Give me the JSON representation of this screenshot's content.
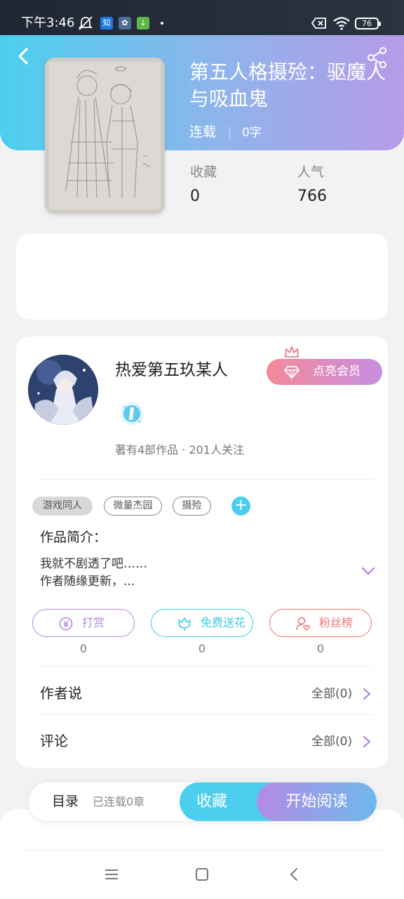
{
  "status_bar": {
    "time": "下午3:46",
    "app_icons": [
      "mute-bell-icon",
      "zhihu-icon",
      "gear-icon",
      "download-icon"
    ],
    "zhihu_glyph": "知",
    "battery": "76"
  },
  "book": {
    "title": "第五人格摄殓：驱魔人与吸血鬼",
    "status": "连载",
    "words": "0字",
    "stats": {
      "collect_label": "收藏",
      "collect_value": "0",
      "popularity_label": "人气",
      "popularity_value": "766"
    }
  },
  "author": {
    "name": "热爱第五玖某人",
    "vip_button": "点亮会员",
    "meta": "著有4部作品 · 201人关注"
  },
  "tags": [
    "游戏同人",
    "微量杰园",
    "摄殓"
  ],
  "tag_add": "+",
  "intro": {
    "title": "作品简介：",
    "lines": [
      "我就不剧透了吧……",
      "作者随缘更新，..."
    ]
  },
  "actions": [
    {
      "label": "打赏",
      "count": "0",
      "color": "#b58be3",
      "icon": "yen-coin-icon"
    },
    {
      "label": "免费送花",
      "count": "0",
      "color": "#3ecbe8",
      "icon": "flower-icon"
    },
    {
      "label": "粉丝榜",
      "count": "0",
      "color": "#ea7878",
      "icon": "fan-list-icon"
    }
  ],
  "rows": [
    {
      "label": "作者说",
      "value": "全部(0)"
    },
    {
      "label": "评论",
      "value": "全部(0)"
    }
  ],
  "bottom_bar": {
    "toc": "目录",
    "toc_status": "已连载0章",
    "collect": "收藏",
    "read": "开始阅读"
  },
  "colors": {
    "accent_cyan": "#4ccfee",
    "accent_purple": "#b79ae8",
    "vip_pink": "#f58a9a"
  }
}
